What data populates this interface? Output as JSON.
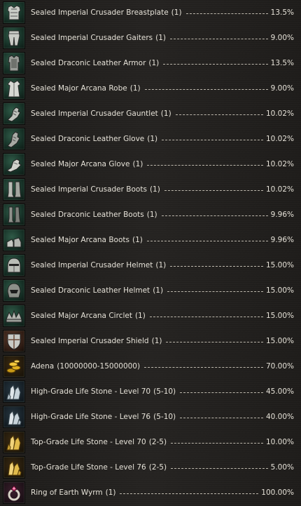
{
  "drop_list": {
    "items": [
      {
        "name": "Sealed Imperial Crusader Breastplate",
        "count": "(1)",
        "chance": "13.5%",
        "icon": "breastplate-icon",
        "icon_bg": "armor"
      },
      {
        "name": "Sealed Imperial Crusader Gaiters",
        "count": "(1)",
        "chance": "9.00%",
        "icon": "gaiters-icon",
        "icon_bg": "armor"
      },
      {
        "name": "Sealed Draconic Leather Armor",
        "count": "(1)",
        "chance": "13.5%",
        "icon": "leather-armor-icon",
        "icon_bg": "armor"
      },
      {
        "name": "Sealed Major Arcana Robe",
        "count": "(1)",
        "chance": "9.00%",
        "icon": "robe-icon",
        "icon_bg": "armor"
      },
      {
        "name": "Sealed Imperial Crusader Gauntlet",
        "count": "(1)",
        "chance": "10.02%",
        "icon": "gauntlet-icon",
        "icon_bg": "armor"
      },
      {
        "name": "Sealed Draconic Leather Glove",
        "count": "(1)",
        "chance": "10.02%",
        "icon": "glove-icon",
        "icon_bg": "armor"
      },
      {
        "name": "Sealed Major Arcana Glove",
        "count": "(1)",
        "chance": "10.02%",
        "icon": "glove-icon",
        "icon_bg": "armor"
      },
      {
        "name": "Sealed Imperial Crusader Boots",
        "count": "(1)",
        "chance": "10.02%",
        "icon": "boots-icon",
        "icon_bg": "armor"
      },
      {
        "name": "Sealed Draconic Leather Boots",
        "count": "(1)",
        "chance": "9.96%",
        "icon": "boots-icon",
        "icon_bg": "armor"
      },
      {
        "name": "Sealed Major Arcana Boots",
        "count": "(1)",
        "chance": "9.96%",
        "icon": "shoes-icon",
        "icon_bg": "armor"
      },
      {
        "name": "Sealed Imperial Crusader Helmet",
        "count": "(1)",
        "chance": "15.00%",
        "icon": "helmet-icon",
        "icon_bg": "armor"
      },
      {
        "name": "Sealed Draconic Leather Helmet",
        "count": "(1)",
        "chance": "15.00%",
        "icon": "helmet-icon",
        "icon_bg": "armor"
      },
      {
        "name": "Sealed Major Arcana Circlet",
        "count": "(1)",
        "chance": "15.00%",
        "icon": "circlet-icon",
        "icon_bg": "armor"
      },
      {
        "name": "Sealed Imperial Crusader Shield",
        "count": "(1)",
        "chance": "15.00%",
        "icon": "shield-icon",
        "icon_bg": "shield"
      },
      {
        "name": "Adena",
        "count": "(10000000-15000000)",
        "chance": "70.00%",
        "icon": "adena-icon",
        "icon_bg": "gold"
      },
      {
        "name": "High-Grade Life Stone - Level 70",
        "count": "(5-10)",
        "chance": "45.00%",
        "icon": "life-stone-icon",
        "icon_bg": "stone"
      },
      {
        "name": "High-Grade Life Stone - Level 76",
        "count": "(5-10)",
        "chance": "40.00%",
        "icon": "life-stone-icon",
        "icon_bg": "stone"
      },
      {
        "name": "Top-Grade Life Stone - Level 70",
        "count": "(2-5)",
        "chance": "10.00%",
        "icon": "top-life-stone-icon",
        "icon_bg": "gold"
      },
      {
        "name": "Top-Grade Life Stone - Level 76",
        "count": "(2-5)",
        "chance": "5.00%",
        "icon": "top-life-stone-icon",
        "icon_bg": "gold"
      },
      {
        "name": "Ring of Earth Wyrm",
        "count": "(1)",
        "chance": "100.00%",
        "icon": "ring-icon",
        "icon_bg": "ring"
      }
    ]
  }
}
